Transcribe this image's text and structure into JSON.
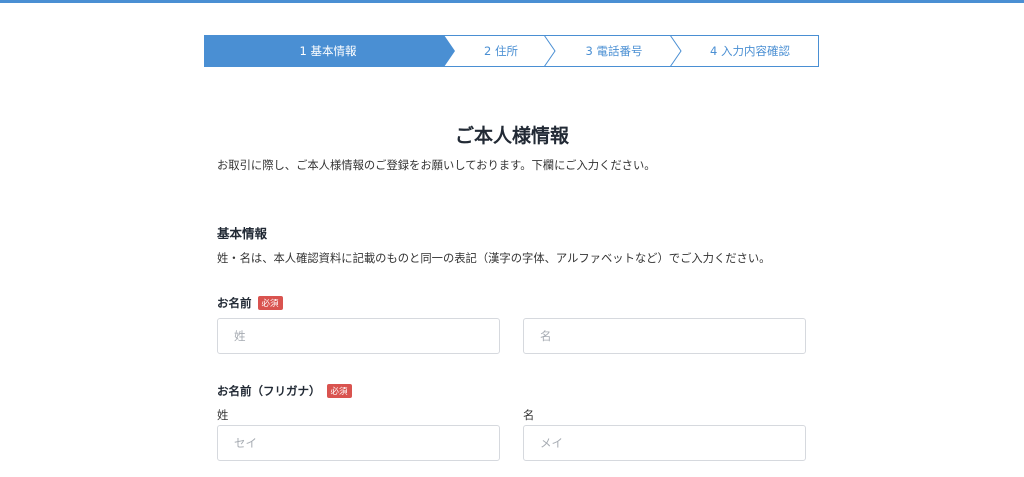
{
  "stepper": {
    "steps": [
      {
        "label": "1 基本情報",
        "active": true
      },
      {
        "label": "2 住所",
        "active": false
      },
      {
        "label": "3 電話番号",
        "active": false
      },
      {
        "label": "4 入力内容確認",
        "active": false
      }
    ],
    "active_color": "#4a8fd3"
  },
  "page": {
    "title": "ご本人様情報",
    "intro": "お取引に際し、ご本人様情報のご登録をお願いしております。下欄にご入力ください。"
  },
  "basic_info": {
    "title": "基本情報",
    "note": "姓・名は、本人確認資料に記載のものと同一の表記（漢字の字体、アルファベットなど）でご入力ください。"
  },
  "name_field": {
    "label": "お名前",
    "required_badge": "必須",
    "last_name_placeholder": "姓",
    "first_name_placeholder": "名"
  },
  "kana_field": {
    "label": "お名前（フリガナ）",
    "required_badge": "必須",
    "last_name_label": "姓",
    "first_name_label": "名",
    "last_name_placeholder": "セイ",
    "first_name_placeholder": "メイ"
  },
  "colors": {
    "accent": "#4a8fd3",
    "required": "#d9534f"
  }
}
